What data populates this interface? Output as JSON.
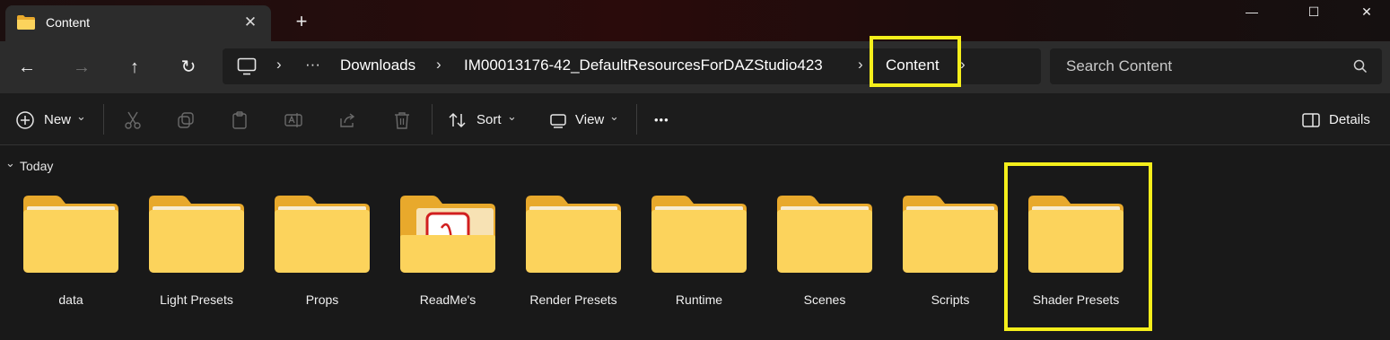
{
  "window": {
    "tab_title": "Content",
    "close_tab_glyph": "✕",
    "new_tab_glyph": "+",
    "minimize_glyph": "—",
    "maximize_glyph": "☐",
    "close_glyph": "✕"
  },
  "navigation": {
    "back_glyph": "←",
    "forward_glyph": "→",
    "up_glyph": "↑",
    "refresh_glyph": "↻",
    "breadcrumb": {
      "chevron": "›",
      "overflow": "···",
      "items": [
        "Downloads",
        "IM00013176-42_DefaultResourcesForDAZStudio423",
        "Content"
      ]
    },
    "search": {
      "placeholder": "Search Content"
    }
  },
  "toolbar": {
    "new_label": "New",
    "sort_label": "Sort",
    "view_label": "View",
    "more_glyph": "•••",
    "details_label": "Details",
    "dropdown_glyph": "⌄"
  },
  "content": {
    "group_chevron": "⌄",
    "group_label": "Today",
    "folders": [
      {
        "name": "data",
        "icon": "folder-icon"
      },
      {
        "name": "Light Presets",
        "icon": "folder-icon"
      },
      {
        "name": "Props",
        "icon": "folder-icon"
      },
      {
        "name": "ReadMe's",
        "icon": "folder-pdf-icon"
      },
      {
        "name": "Render Presets",
        "icon": "folder-icon"
      },
      {
        "name": "Runtime",
        "icon": "folder-icon"
      },
      {
        "name": "Scenes",
        "icon": "folder-icon"
      },
      {
        "name": "Scripts",
        "icon": "folder-icon"
      },
      {
        "name": "Shader Presets",
        "icon": "folder-icon"
      }
    ]
  },
  "colors": {
    "highlight": "#f4ee1b",
    "folder_front": "#fcd35c",
    "folder_back": "#e8a92c"
  }
}
